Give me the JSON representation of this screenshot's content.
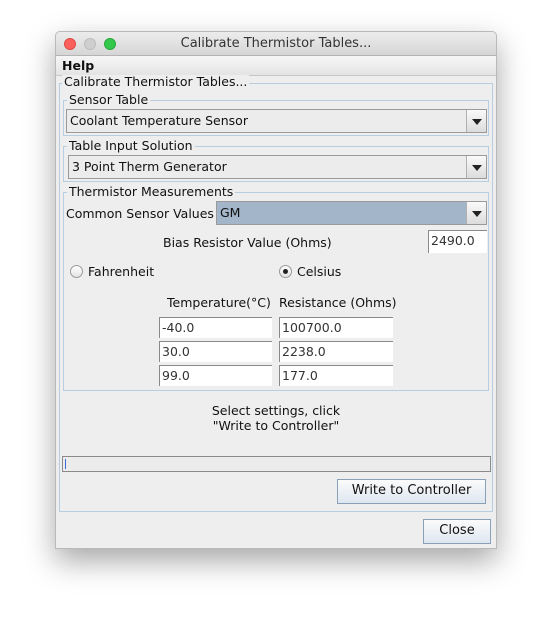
{
  "window": {
    "title": "Calibrate Thermistor Tables..."
  },
  "menu": {
    "help": "Help"
  },
  "panel_title": "Calibrate Thermistor Tables...",
  "sensor_table": {
    "label": "Sensor Table",
    "value": "Coolant Temperature Sensor"
  },
  "table_input": {
    "label": "Table Input Solution",
    "value": "3 Point Therm Generator"
  },
  "measurements": {
    "label": "Thermistor Measurements",
    "common_label": "Common Sensor Values",
    "common_value": "GM",
    "bias_label": "Bias Resistor Value (Ohms)",
    "bias_value": "2490.0",
    "fahrenheit": "Fahrenheit",
    "celsius": "Celsius",
    "selected_unit": "Celsius",
    "temp_header": "Temperature(°C)",
    "res_header": "Resistance (Ohms)",
    "rows": [
      {
        "temp": "-40.0",
        "res": "100700.0"
      },
      {
        "temp": "30.0",
        "res": "2238.0"
      },
      {
        "temp": "99.0",
        "res": "177.0"
      }
    ]
  },
  "message": {
    "line1": "Select settings, click",
    "line2": "\"Write to Controller\""
  },
  "status_value": "",
  "buttons": {
    "write": "Write to Controller",
    "close": "Close"
  },
  "colors": {
    "close": "#fc605c",
    "minimize": "#cfcfcf",
    "zoom": "#34c84a",
    "selected_combo": "#a3b5c9"
  }
}
